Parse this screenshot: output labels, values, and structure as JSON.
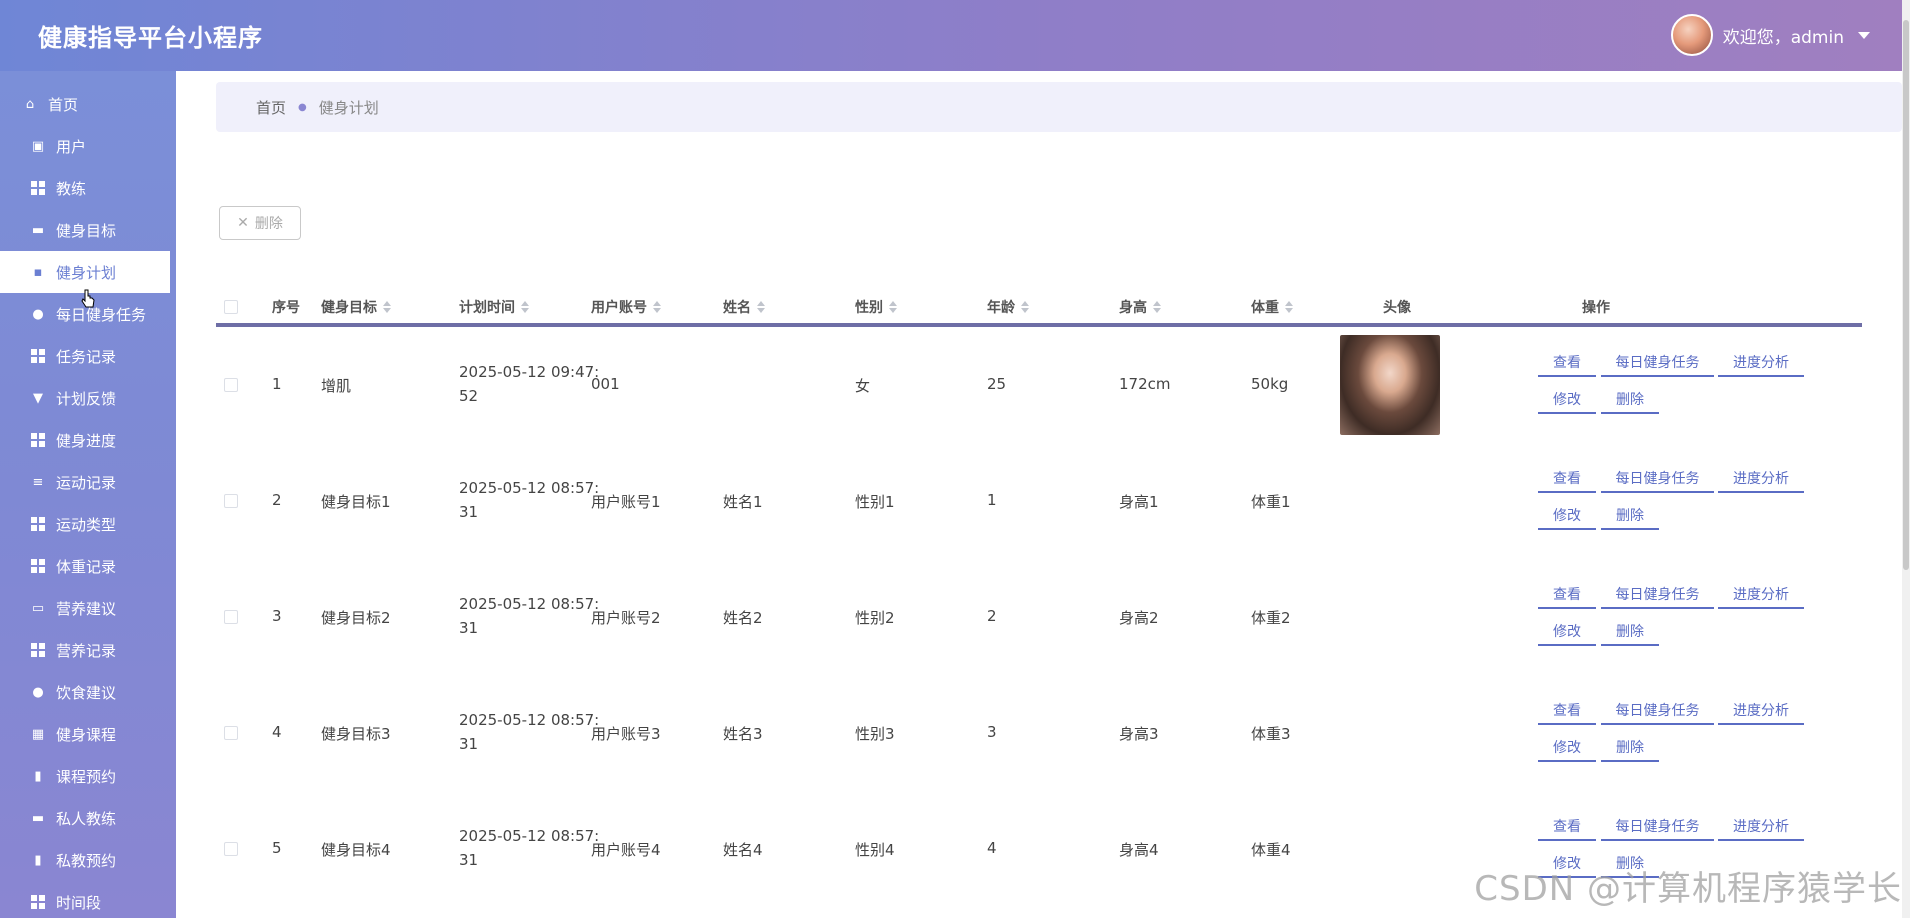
{
  "header": {
    "app_title": "健康指导平台小程序",
    "welcome": "欢迎您，admin"
  },
  "sidebar": {
    "items": [
      {
        "label": "首页",
        "icon": "home-icon"
      },
      {
        "label": "用户",
        "icon": "clipboard-icon"
      },
      {
        "label": "教练",
        "icon": "grid-icon"
      },
      {
        "label": "健身目标",
        "icon": "briefcase-icon"
      },
      {
        "label": "健身计划",
        "icon": "chat-icon",
        "active": true
      },
      {
        "label": "每日健身任务",
        "icon": "bulb-icon"
      },
      {
        "label": "任务记录",
        "icon": "grid-icon"
      },
      {
        "label": "计划反馈",
        "icon": "marker-icon"
      },
      {
        "label": "健身进度",
        "icon": "grid-icon"
      },
      {
        "label": "运动记录",
        "icon": "list-icon"
      },
      {
        "label": "运动类型",
        "icon": "grid-icon"
      },
      {
        "label": "体重记录",
        "icon": "grid-icon"
      },
      {
        "label": "营养建议",
        "icon": "printer-icon"
      },
      {
        "label": "营养记录",
        "icon": "grid-icon"
      },
      {
        "label": "饮食建议",
        "icon": "user-icon"
      },
      {
        "label": "健身课程",
        "icon": "document-icon"
      },
      {
        "label": "课程预约",
        "icon": "bar-chart-icon"
      },
      {
        "label": "私人教练",
        "icon": "wallet-icon"
      },
      {
        "label": "私教预约",
        "icon": "book-icon"
      },
      {
        "label": "时间段",
        "icon": "grid-icon"
      }
    ]
  },
  "breadcrumb": {
    "home": "首页",
    "current": "健身计划"
  },
  "toolbar": {
    "delete_label": "删除"
  },
  "table": {
    "headers": {
      "index": "序号",
      "goal": "健身目标",
      "time": "计划时间",
      "account": "用户账号",
      "name": "姓名",
      "gender": "性别",
      "age": "年龄",
      "height": "身高",
      "weight": "体重",
      "avatar": "头像",
      "ops": "操作"
    },
    "rows": [
      {
        "index": "1",
        "goal": "增肌",
        "time1": "2025-05-12 09:47:",
        "time2": "52",
        "account": "001",
        "name": "",
        "gender": "女",
        "age": "25",
        "height": "172cm",
        "weight": "50kg",
        "has_photo": true
      },
      {
        "index": "2",
        "goal": "健身目标1",
        "time1": "2025-05-12 08:57:",
        "time2": "31",
        "account": "用户账号1",
        "name": "姓名1",
        "gender": "性别1",
        "age": "1",
        "height": "身高1",
        "weight": "体重1"
      },
      {
        "index": "3",
        "goal": "健身目标2",
        "time1": "2025-05-12 08:57:",
        "time2": "31",
        "account": "用户账号2",
        "name": "姓名2",
        "gender": "性别2",
        "age": "2",
        "height": "身高2",
        "weight": "体重2"
      },
      {
        "index": "4",
        "goal": "健身目标3",
        "time1": "2025-05-12 08:57:",
        "time2": "31",
        "account": "用户账号3",
        "name": "姓名3",
        "gender": "性别3",
        "age": "3",
        "height": "身高3",
        "weight": "体重3"
      },
      {
        "index": "5",
        "goal": "健身目标4",
        "time1": "2025-05-12 08:57:",
        "time2": "31",
        "account": "用户账号4",
        "name": "姓名4",
        "gender": "性别4",
        "age": "4",
        "height": "身高4",
        "weight": "体重4"
      }
    ],
    "ops": {
      "view": "查看",
      "daily": "每日健身任务",
      "progress": "进度分析",
      "edit": "修改",
      "delete": "删除"
    }
  },
  "watermark": "CSDN @计算机程序猿学长"
}
